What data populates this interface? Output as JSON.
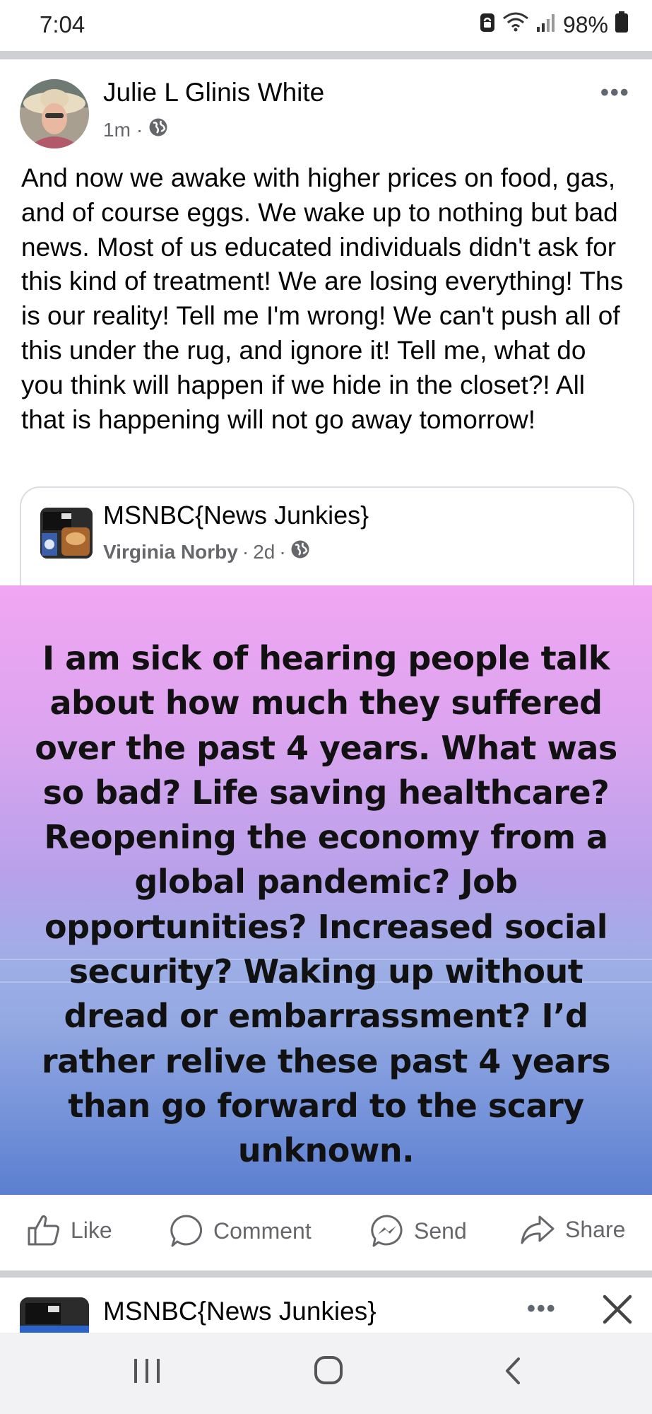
{
  "status_bar": {
    "time": "7:04",
    "battery": "98%",
    "icons": [
      "sync-lock-icon",
      "wifi-icon",
      "signal-icon",
      "battery-icon"
    ]
  },
  "post": {
    "author": "Julie L Glinis White",
    "time": "1m",
    "separator": "·",
    "privacy_icon": "globe-icon",
    "more": "•••",
    "text": "And now we awake with higher prices on food, gas, and of course eggs. We wake up to nothing but bad news. Most of us educated individuals didn't ask for this kind of treatment! We are losing everything! Ths is our reality! Tell me I'm wrong! We can't push all of this under the rug, and ignore it! Tell me, what do you think will happen if we hide in the closet?! All that is happening will not go away tomorrow!"
  },
  "shared": {
    "group": "MSNBC{News Junkies}",
    "poster": "Virginia Norby",
    "time": "2d",
    "separator": "·",
    "meme_lines": [
      "I am sick of hearing people talk",
      "about how much they suffered",
      "over the past 4 years. What was",
      "so bad? Life saving healthcare?",
      "Reopening the economy from a",
      "global pandemic? Job",
      "opportunities? Increased social",
      "security? Waking up without",
      "dread or embarrassment? I’d",
      "rather relive these past 4 years",
      "than go forward to the scary",
      "unknown."
    ]
  },
  "actions": {
    "like": "Like",
    "comment": "Comment",
    "send": "Send",
    "share": "Share"
  },
  "next_post": {
    "group": "MSNBC{News Junkies}",
    "more": "•••"
  },
  "colors": {
    "meta_gray": "#65676b",
    "divider": "#ced0d4",
    "meme_top": "#f1a6f2",
    "meme_bottom": "#5b7fcf"
  }
}
